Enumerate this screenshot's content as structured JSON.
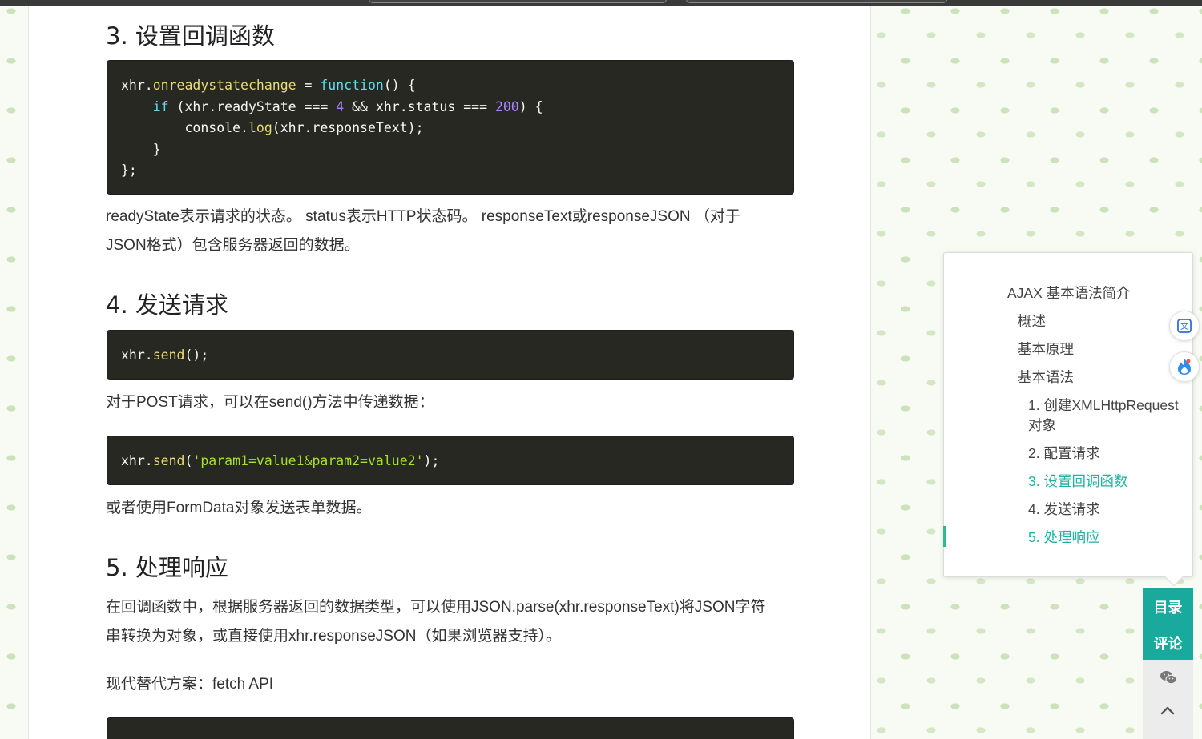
{
  "browser": {
    "tab_strip": ""
  },
  "article": {
    "sections": [
      {
        "heading": "3. 设置回调函数"
      },
      {
        "heading": "4. 发送请求"
      },
      {
        "heading": "5. 处理响应"
      }
    ],
    "code1": {
      "l1_a": "xhr.",
      "l1_b": "onreadystatechange",
      "l1_c": " = ",
      "l1_d": "function",
      "l1_e": "() {",
      "l2_a": "    ",
      "l2_b": "if",
      "l2_c": " (xhr.readyState === ",
      "l2_d": "4",
      "l2_e": " && xhr.status === ",
      "l2_f": "200",
      "l2_g": ") {",
      "l3_a": "        console.",
      "l3_b": "log",
      "l3_c": "(xhr.responseText);",
      "l4": "    }",
      "l5": "};"
    },
    "para1_line1": "readyState表示请求的状态。 status表示HTTP状态码。 responseText或responseJSON （对于",
    "para1_line2": "JSON格式）包含服务器返回的数据。",
    "code2": {
      "a": "xhr.",
      "b": "send",
      "c": "();"
    },
    "para2": "对于POST请求，可以在send()方法中传递数据：",
    "code3": {
      "a": "xhr.",
      "b": "send",
      "c": "(",
      "d": "'param1=value1&param2=value2'",
      "e": ");"
    },
    "para3": "或者使用FormData对象发送表单数据。",
    "para4_line1": "在回调函数中，根据服务器返回的数据类型，可以使用JSON.parse(xhr.responseText)将JSON字符",
    "para4_line2": "串转换为对象，或直接使用xhr.responseJSON（如果浏览器支持）。",
    "para5": "现代替代方案：fetch API"
  },
  "toc": {
    "items": [
      {
        "label": "AJAX 基本语法简介",
        "active": false
      },
      {
        "label": "概述",
        "active": false
      },
      {
        "label": "基本原理",
        "active": false
      },
      {
        "label": "基本语法",
        "active": false
      },
      {
        "label": "1. 创建XMLHttpRequest",
        "active": false
      },
      {
        "label": "对象",
        "active": false
      },
      {
        "label": "2. 配置请求",
        "active": false
      },
      {
        "label": "3. 设置回调函数",
        "active": true
      },
      {
        "label": "4. 发送请求",
        "active": false
      },
      {
        "label": "5. 处理响应",
        "active": true
      }
    ]
  },
  "sidebar": {
    "toc_button": "目录",
    "comment_button": "评论",
    "icons": [
      "translate-icon",
      "flame-icon",
      "wechat-icon",
      "chevron-up-icon"
    ]
  },
  "colors": {
    "accent": "#1aa99d",
    "code_bg": "#272822",
    "toc_active": "#22b2a3"
  }
}
